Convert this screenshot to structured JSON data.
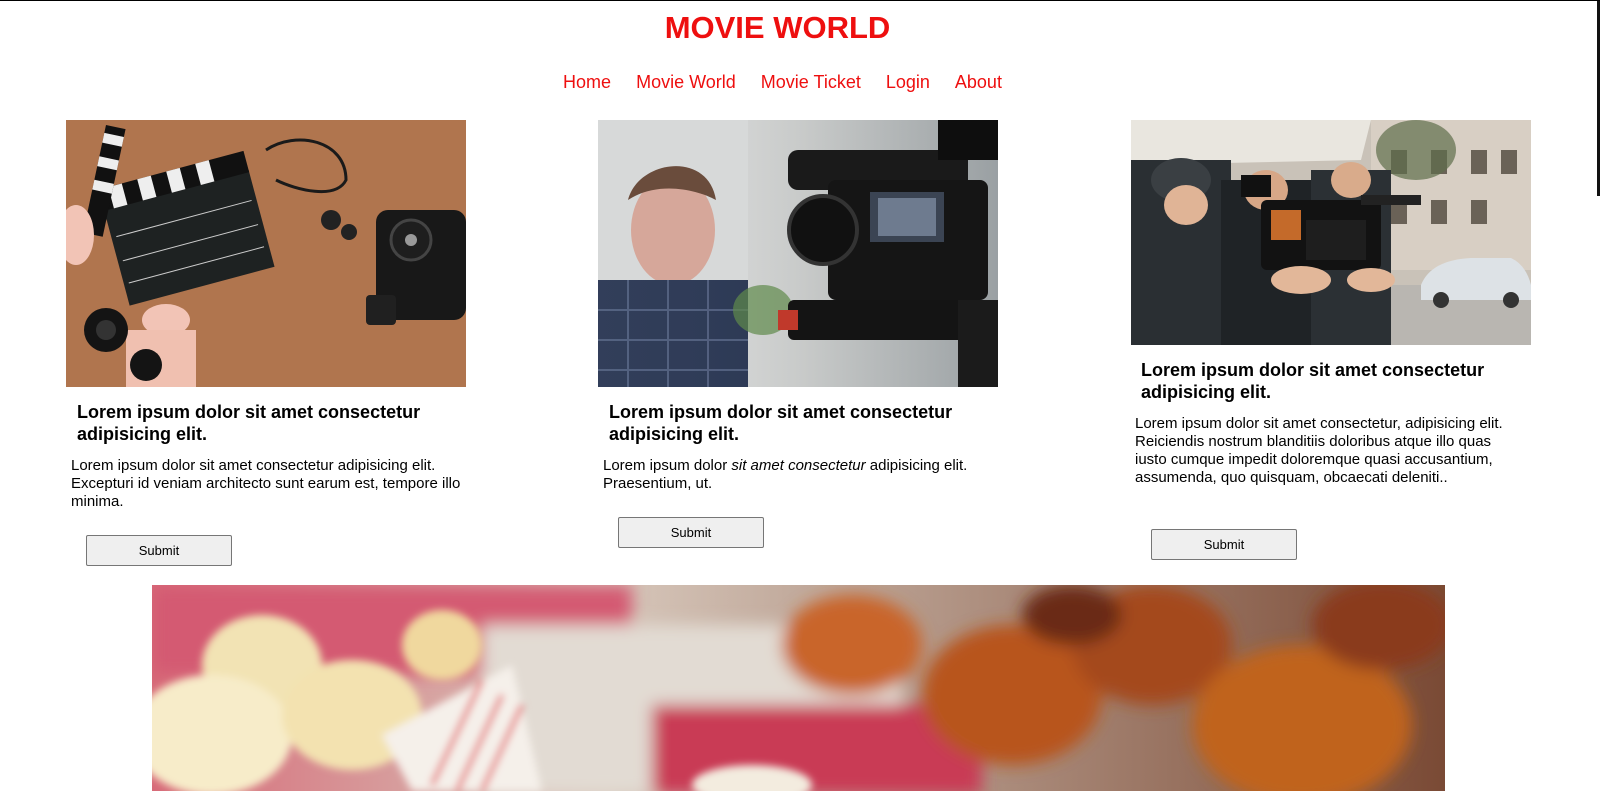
{
  "header": {
    "title": "MOVIE WORLD"
  },
  "nav": {
    "items": [
      "Home",
      "Movie World",
      "Movie Ticket",
      "Login",
      "About"
    ]
  },
  "cards": [
    {
      "image_alt": "clapperboard-and-camera-photo",
      "heading": "Lorem ipsum dolor sit amet consectetur adipisicing elit.",
      "text": "Lorem ipsum dolor sit amet consectetur adipisicing elit. Excepturi id veniam architecto sunt earum est, tempore illo minima.",
      "button": "Submit"
    },
    {
      "image_alt": "camera-operator-photo",
      "heading": "Lorem ipsum dolor sit amet consectetur adipisicing elit.",
      "text_before": "Lorem ipsum dolor ",
      "text_italic": "sit amet consectetur",
      "text_after": " adipisicing elit. Praesentium, ut.",
      "button": "Submit"
    },
    {
      "image_alt": "film-crew-street-photo",
      "heading": "Lorem ipsum dolor sit amet consectetur adipisicing elit.",
      "text": "Lorem ipsum dolor sit amet consectetur, adipisicing elit. Reiciendis nostrum blanditiis doloribus atque illo quas iusto cumque impedit doloremque quasi accusantium, assumenda, quo quisquam, obcaecati deleniti..",
      "button": "Submit"
    }
  ],
  "banner": {
    "image_alt": "popcorn-banner-photo"
  },
  "colors": {
    "accent": "#ee0f0f"
  }
}
